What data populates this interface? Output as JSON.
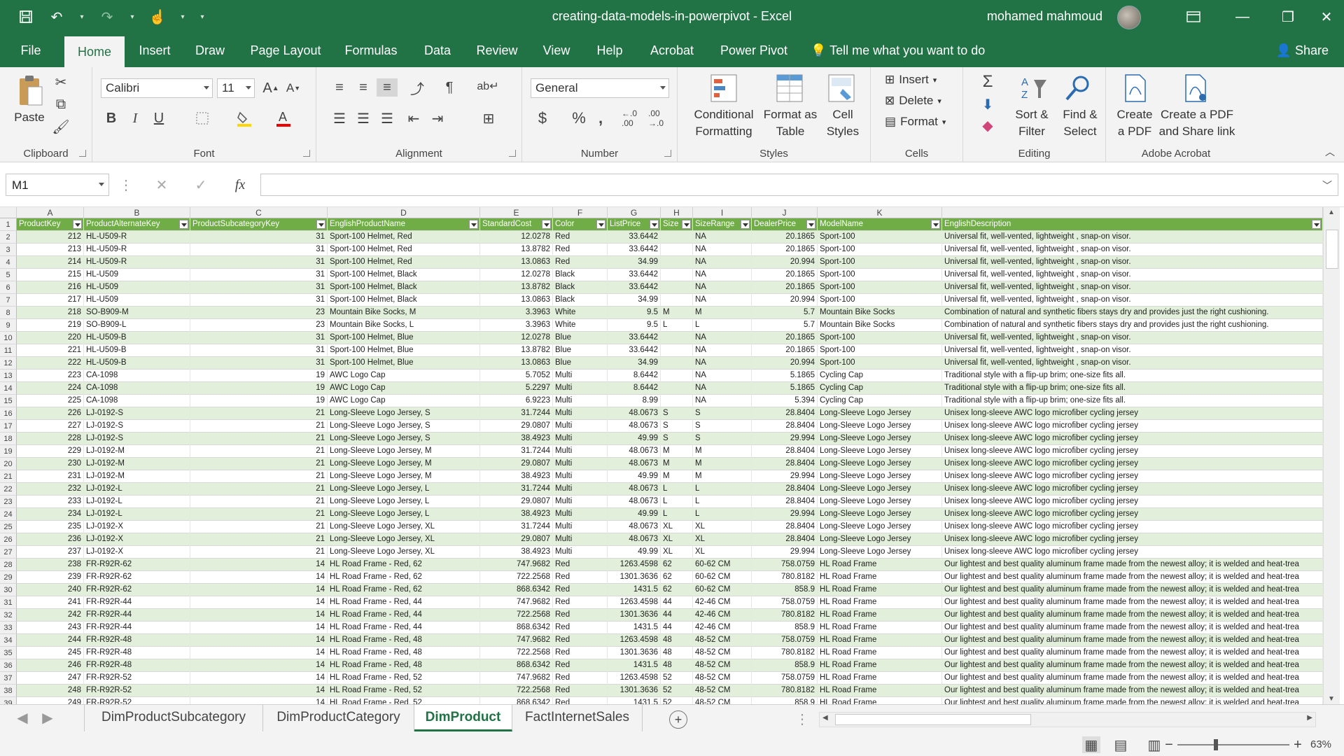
{
  "window": {
    "title": "creating-data-models-in-powerpivot  -  Excel",
    "user": "mohamed mahmoud",
    "accent": "#217346"
  },
  "tabs": [
    "File",
    "Home",
    "Insert",
    "Draw",
    "Page Layout",
    "Formulas",
    "Data",
    "Review",
    "View",
    "Help",
    "Acrobat",
    "Power Pivot"
  ],
  "active_tab": "Home",
  "tell_me": "Tell me what you want to do",
  "share": "Share",
  "ribbon": {
    "clipboard": {
      "label": "Clipboard",
      "paste": "Paste"
    },
    "font": {
      "label": "Font",
      "name": "Calibri",
      "size": "11",
      "bold": "B",
      "italic": "I",
      "underline": "U"
    },
    "alignment": {
      "label": "Alignment"
    },
    "number": {
      "label": "Number",
      "format": "General",
      "currency": "$",
      "percent": "%",
      "comma": ","
    },
    "styles": {
      "label": "Styles",
      "conditional": [
        "Conditional",
        "Formatting"
      ],
      "format_table": [
        "Format as",
        "Table"
      ],
      "cell_styles": [
        "Cell",
        "Styles"
      ]
    },
    "cells": {
      "label": "Cells",
      "insert": "Insert",
      "delete": "Delete",
      "format": "Format"
    },
    "editing": {
      "label": "Editing",
      "sort": [
        "Sort &",
        "Filter"
      ],
      "find": [
        "Find &",
        "Select"
      ]
    },
    "acrobat": {
      "label": "Adobe Acrobat",
      "create_pdf": [
        "Create",
        "a PDF"
      ],
      "create_share": [
        "Create a PDF",
        "and Share link"
      ]
    }
  },
  "formula_bar": {
    "name_box": "M1",
    "fx": "fx",
    "value": ""
  },
  "columns": [
    "A",
    "B",
    "C",
    "D",
    "E",
    "F",
    "G",
    "H",
    "I",
    "J",
    "K"
  ],
  "headers": [
    "ProductKey",
    "ProductAlternateKey",
    "ProductSubcategoryKey",
    "EnglishProductName",
    "StandardCost",
    "Color",
    "ListPrice",
    "Size",
    "SizeRange",
    "DealerPrice",
    "ModelName",
    "EnglishDescription"
  ],
  "rows": [
    [
      "212",
      "HL-U509-R",
      "31",
      "Sport-100 Helmet, Red",
      "12.0278",
      "Red",
      "33.6442",
      "",
      "NA",
      "20.1865",
      "Sport-100",
      "Universal fit, well-vented, lightweight , snap-on visor."
    ],
    [
      "213",
      "HL-U509-R",
      "31",
      "Sport-100 Helmet, Red",
      "13.8782",
      "Red",
      "33.6442",
      "",
      "NA",
      "20.1865",
      "Sport-100",
      "Universal fit, well-vented, lightweight , snap-on visor."
    ],
    [
      "214",
      "HL-U509-R",
      "31",
      "Sport-100 Helmet, Red",
      "13.0863",
      "Red",
      "34.99",
      "",
      "NA",
      "20.994",
      "Sport-100",
      "Universal fit, well-vented, lightweight , snap-on visor."
    ],
    [
      "215",
      "HL-U509",
      "31",
      "Sport-100 Helmet, Black",
      "12.0278",
      "Black",
      "33.6442",
      "",
      "NA",
      "20.1865",
      "Sport-100",
      "Universal fit, well-vented, lightweight , snap-on visor."
    ],
    [
      "216",
      "HL-U509",
      "31",
      "Sport-100 Helmet, Black",
      "13.8782",
      "Black",
      "33.6442",
      "",
      "NA",
      "20.1865",
      "Sport-100",
      "Universal fit, well-vented, lightweight , snap-on visor."
    ],
    [
      "217",
      "HL-U509",
      "31",
      "Sport-100 Helmet, Black",
      "13.0863",
      "Black",
      "34.99",
      "",
      "NA",
      "20.994",
      "Sport-100",
      "Universal fit, well-vented, lightweight , snap-on visor."
    ],
    [
      "218",
      "SO-B909-M",
      "23",
      "Mountain Bike Socks, M",
      "3.3963",
      "White",
      "9.5",
      "M",
      "M",
      "5.7",
      "Mountain Bike Socks",
      "Combination of natural and synthetic fibers stays dry and provides just the right cushioning."
    ],
    [
      "219",
      "SO-B909-L",
      "23",
      "Mountain Bike Socks, L",
      "3.3963",
      "White",
      "9.5",
      "L",
      "L",
      "5.7",
      "Mountain Bike Socks",
      "Combination of natural and synthetic fibers stays dry and provides just the right cushioning."
    ],
    [
      "220",
      "HL-U509-B",
      "31",
      "Sport-100 Helmet, Blue",
      "12.0278",
      "Blue",
      "33.6442",
      "",
      "NA",
      "20.1865",
      "Sport-100",
      "Universal fit, well-vented, lightweight , snap-on visor."
    ],
    [
      "221",
      "HL-U509-B",
      "31",
      "Sport-100 Helmet, Blue",
      "13.8782",
      "Blue",
      "33.6442",
      "",
      "NA",
      "20.1865",
      "Sport-100",
      "Universal fit, well-vented, lightweight , snap-on visor."
    ],
    [
      "222",
      "HL-U509-B",
      "31",
      "Sport-100 Helmet, Blue",
      "13.0863",
      "Blue",
      "34.99",
      "",
      "NA",
      "20.994",
      "Sport-100",
      "Universal fit, well-vented, lightweight , snap-on visor."
    ],
    [
      "223",
      "CA-1098",
      "19",
      "AWC Logo Cap",
      "5.7052",
      "Multi",
      "8.6442",
      "",
      "NA",
      "5.1865",
      "Cycling Cap",
      "Traditional style with a flip-up brim; one-size fits all."
    ],
    [
      "224",
      "CA-1098",
      "19",
      "AWC Logo Cap",
      "5.2297",
      "Multi",
      "8.6442",
      "",
      "NA",
      "5.1865",
      "Cycling Cap",
      "Traditional style with a flip-up brim; one-size fits all."
    ],
    [
      "225",
      "CA-1098",
      "19",
      "AWC Logo Cap",
      "6.9223",
      "Multi",
      "8.99",
      "",
      "NA",
      "5.394",
      "Cycling Cap",
      "Traditional style with a flip-up brim; one-size fits all."
    ],
    [
      "226",
      "LJ-0192-S",
      "21",
      "Long-Sleeve Logo Jersey, S",
      "31.7244",
      "Multi",
      "48.0673",
      "S",
      "S",
      "28.8404",
      "Long-Sleeve Logo Jersey",
      "Unisex long-sleeve AWC logo microfiber cycling jersey"
    ],
    [
      "227",
      "LJ-0192-S",
      "21",
      "Long-Sleeve Logo Jersey, S",
      "29.0807",
      "Multi",
      "48.0673",
      "S",
      "S",
      "28.8404",
      "Long-Sleeve Logo Jersey",
      "Unisex long-sleeve AWC logo microfiber cycling jersey"
    ],
    [
      "228",
      "LJ-0192-S",
      "21",
      "Long-Sleeve Logo Jersey, S",
      "38.4923",
      "Multi",
      "49.99",
      "S",
      "S",
      "29.994",
      "Long-Sleeve Logo Jersey",
      "Unisex long-sleeve AWC logo microfiber cycling jersey"
    ],
    [
      "229",
      "LJ-0192-M",
      "21",
      "Long-Sleeve Logo Jersey, M",
      "31.7244",
      "Multi",
      "48.0673",
      "M",
      "M",
      "28.8404",
      "Long-Sleeve Logo Jersey",
      "Unisex long-sleeve AWC logo microfiber cycling jersey"
    ],
    [
      "230",
      "LJ-0192-M",
      "21",
      "Long-Sleeve Logo Jersey, M",
      "29.0807",
      "Multi",
      "48.0673",
      "M",
      "M",
      "28.8404",
      "Long-Sleeve Logo Jersey",
      "Unisex long-sleeve AWC logo microfiber cycling jersey"
    ],
    [
      "231",
      "LJ-0192-M",
      "21",
      "Long-Sleeve Logo Jersey, M",
      "38.4923",
      "Multi",
      "49.99",
      "M",
      "M",
      "29.994",
      "Long-Sleeve Logo Jersey",
      "Unisex long-sleeve AWC logo microfiber cycling jersey"
    ],
    [
      "232",
      "LJ-0192-L",
      "21",
      "Long-Sleeve Logo Jersey, L",
      "31.7244",
      "Multi",
      "48.0673",
      "L",
      "L",
      "28.8404",
      "Long-Sleeve Logo Jersey",
      "Unisex long-sleeve AWC logo microfiber cycling jersey"
    ],
    [
      "233",
      "LJ-0192-L",
      "21",
      "Long-Sleeve Logo Jersey, L",
      "29.0807",
      "Multi",
      "48.0673",
      "L",
      "L",
      "28.8404",
      "Long-Sleeve Logo Jersey",
      "Unisex long-sleeve AWC logo microfiber cycling jersey"
    ],
    [
      "234",
      "LJ-0192-L",
      "21",
      "Long-Sleeve Logo Jersey, L",
      "38.4923",
      "Multi",
      "49.99",
      "L",
      "L",
      "29.994",
      "Long-Sleeve Logo Jersey",
      "Unisex long-sleeve AWC logo microfiber cycling jersey"
    ],
    [
      "235",
      "LJ-0192-X",
      "21",
      "Long-Sleeve Logo Jersey, XL",
      "31.7244",
      "Multi",
      "48.0673",
      "XL",
      "XL",
      "28.8404",
      "Long-Sleeve Logo Jersey",
      "Unisex long-sleeve AWC logo microfiber cycling jersey"
    ],
    [
      "236",
      "LJ-0192-X",
      "21",
      "Long-Sleeve Logo Jersey, XL",
      "29.0807",
      "Multi",
      "48.0673",
      "XL",
      "XL",
      "28.8404",
      "Long-Sleeve Logo Jersey",
      "Unisex long-sleeve AWC logo microfiber cycling jersey"
    ],
    [
      "237",
      "LJ-0192-X",
      "21",
      "Long-Sleeve Logo Jersey, XL",
      "38.4923",
      "Multi",
      "49.99",
      "XL",
      "XL",
      "29.994",
      "Long-Sleeve Logo Jersey",
      "Unisex long-sleeve AWC logo microfiber cycling jersey"
    ],
    [
      "238",
      "FR-R92R-62",
      "14",
      "HL Road Frame - Red, 62",
      "747.9682",
      "Red",
      "1263.4598",
      "62",
      "60-62 CM",
      "758.0759",
      "HL Road Frame",
      "Our lightest and best quality aluminum frame made from the newest alloy; it is welded and heat-trea"
    ],
    [
      "239",
      "FR-R92R-62",
      "14",
      "HL Road Frame - Red, 62",
      "722.2568",
      "Red",
      "1301.3636",
      "62",
      "60-62 CM",
      "780.8182",
      "HL Road Frame",
      "Our lightest and best quality aluminum frame made from the newest alloy; it is welded and heat-trea"
    ],
    [
      "240",
      "FR-R92R-62",
      "14",
      "HL Road Frame - Red, 62",
      "868.6342",
      "Red",
      "1431.5",
      "62",
      "60-62 CM",
      "858.9",
      "HL Road Frame",
      "Our lightest and best quality aluminum frame made from the newest alloy; it is welded and heat-trea"
    ],
    [
      "241",
      "FR-R92R-44",
      "14",
      "HL Road Frame - Red, 44",
      "747.9682",
      "Red",
      "1263.4598",
      "44",
      "42-46 CM",
      "758.0759",
      "HL Road Frame",
      "Our lightest and best quality aluminum frame made from the newest alloy; it is welded and heat-trea"
    ],
    [
      "242",
      "FR-R92R-44",
      "14",
      "HL Road Frame - Red, 44",
      "722.2568",
      "Red",
      "1301.3636",
      "44",
      "42-46 CM",
      "780.8182",
      "HL Road Frame",
      "Our lightest and best quality aluminum frame made from the newest alloy; it is welded and heat-trea"
    ],
    [
      "243",
      "FR-R92R-44",
      "14",
      "HL Road Frame - Red, 44",
      "868.6342",
      "Red",
      "1431.5",
      "44",
      "42-46 CM",
      "858.9",
      "HL Road Frame",
      "Our lightest and best quality aluminum frame made from the newest alloy; it is welded and heat-trea"
    ],
    [
      "244",
      "FR-R92R-48",
      "14",
      "HL Road Frame - Red, 48",
      "747.9682",
      "Red",
      "1263.4598",
      "48",
      "48-52 CM",
      "758.0759",
      "HL Road Frame",
      "Our lightest and best quality aluminum frame made from the newest alloy; it is welded and heat-trea"
    ],
    [
      "245",
      "FR-R92R-48",
      "14",
      "HL Road Frame - Red, 48",
      "722.2568",
      "Red",
      "1301.3636",
      "48",
      "48-52 CM",
      "780.8182",
      "HL Road Frame",
      "Our lightest and best quality aluminum frame made from the newest alloy; it is welded and heat-trea"
    ],
    [
      "246",
      "FR-R92R-48",
      "14",
      "HL Road Frame - Red, 48",
      "868.6342",
      "Red",
      "1431.5",
      "48",
      "48-52 CM",
      "858.9",
      "HL Road Frame",
      "Our lightest and best quality aluminum frame made from the newest alloy; it is welded and heat-trea"
    ],
    [
      "247",
      "FR-R92R-52",
      "14",
      "HL Road Frame - Red, 52",
      "747.9682",
      "Red",
      "1263.4598",
      "52",
      "48-52 CM",
      "758.0759",
      "HL Road Frame",
      "Our lightest and best quality aluminum frame made from the newest alloy; it is welded and heat-trea"
    ],
    [
      "248",
      "FR-R92R-52",
      "14",
      "HL Road Frame - Red, 52",
      "722.2568",
      "Red",
      "1301.3636",
      "52",
      "48-52 CM",
      "780.8182",
      "HL Road Frame",
      "Our lightest and best quality aluminum frame made from the newest alloy; it is welded and heat-trea"
    ],
    [
      "249",
      "FR-R92R-52",
      "14",
      "HL Road Frame - Red, 52",
      "868.6342",
      "Red",
      "1431.5",
      "52",
      "48-52 CM",
      "858.9",
      "HL Road Frame",
      "Our lightest and best quality aluminum frame made from the newest alloy; it is welded and heat-trea"
    ]
  ],
  "sheets": [
    "DimProductSubcategory",
    "DimProductCategory",
    "DimProduct",
    "FactInternetSales"
  ],
  "active_sheet": "DimProduct",
  "zoom": "63%",
  "icons": [
    "save-icon",
    "undo-icon",
    "redo-icon",
    "touch-mode-icon",
    "customize-qat-icon",
    "ribbon-display-icon",
    "minimize-icon",
    "restore-icon",
    "close-icon",
    "lightbulb-icon",
    "share-icon"
  ]
}
